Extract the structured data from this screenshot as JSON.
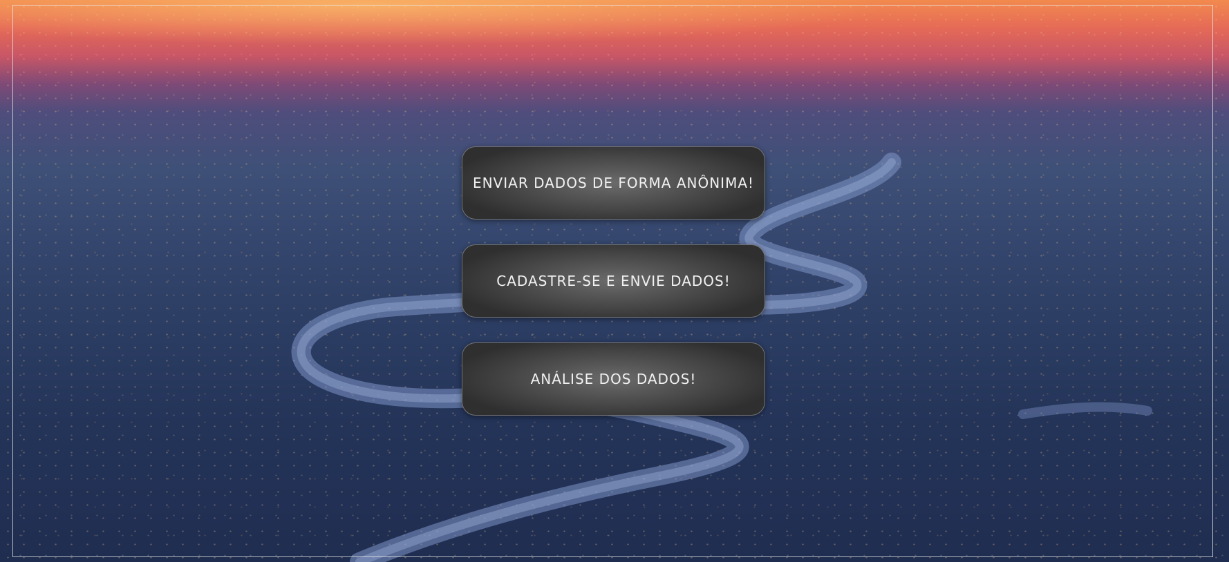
{
  "buttons": {
    "anonymous": "ENVIAR DADOS DE FORMA ANÔNIMA!",
    "register": "CADASTRE-SE E ENVIE DADOS!",
    "analysis": "ANÁLISE DOS DADOS!"
  },
  "colors": {
    "button_center": "#6b6b6b",
    "button_edge": "#2f2f2f",
    "button_text": "#f1f1f1",
    "sky_top": "#f28a4e",
    "city_bottom": "#1f2d50"
  }
}
